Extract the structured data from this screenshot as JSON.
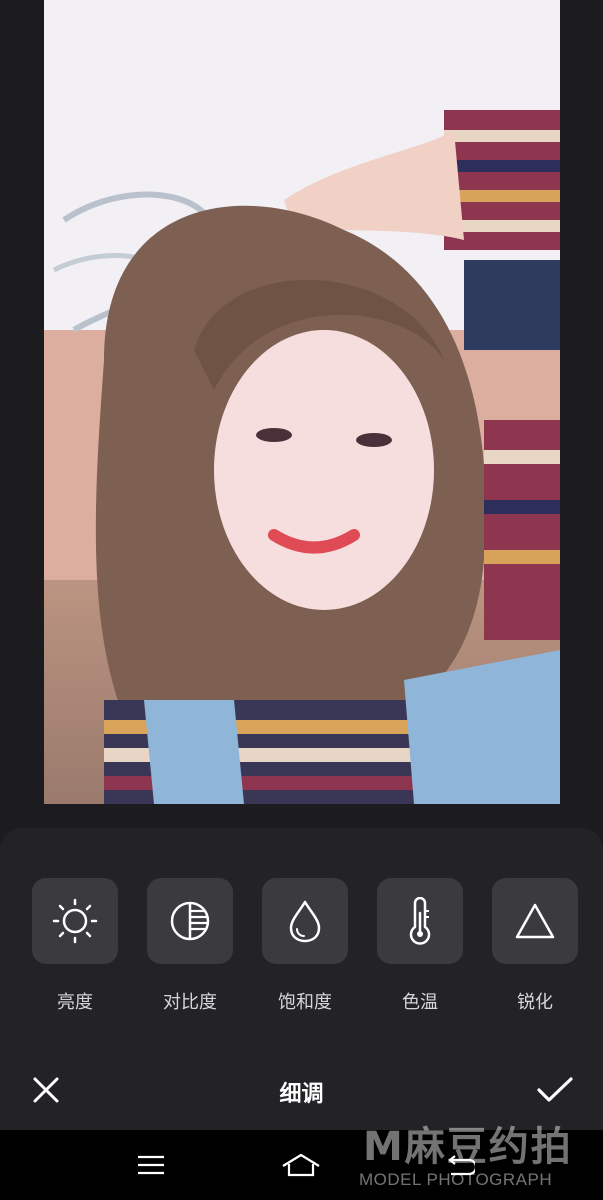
{
  "photo": {
    "description_icon": "portrait-photo"
  },
  "tools": [
    {
      "label": "亮度",
      "icon": "brightness-icon"
    },
    {
      "label": "对比度",
      "icon": "contrast-icon"
    },
    {
      "label": "饱和度",
      "icon": "saturation-icon"
    },
    {
      "label": "色温",
      "icon": "temperature-icon"
    },
    {
      "label": "锐化",
      "icon": "sharpen-icon"
    }
  ],
  "footer": {
    "title": "细调",
    "cancel_icon": "close-icon",
    "confirm_icon": "check-icon"
  },
  "navbar": {
    "items": [
      "menu-icon",
      "home-icon",
      "back-icon"
    ]
  },
  "watermark": {
    "main": "M麻豆约拍",
    "sub": "MODEL PHOTOGRAPH"
  },
  "colors": {
    "background": "#1c1c20",
    "panel": "#232327",
    "button": "#3a3a3f",
    "text": "#d6d6da"
  }
}
